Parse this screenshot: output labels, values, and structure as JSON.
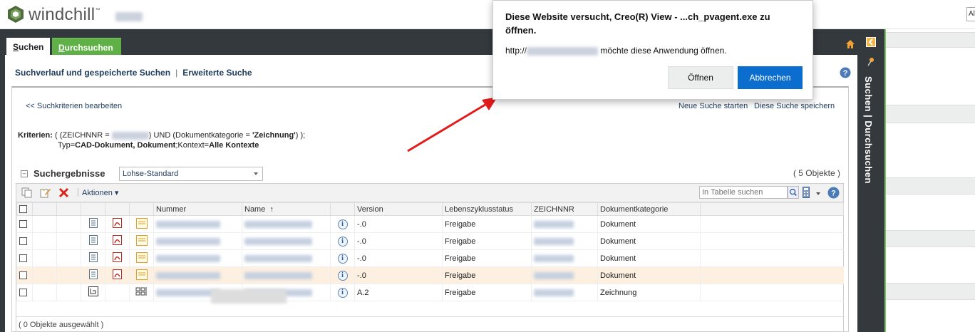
{
  "header": {
    "logo_text": "windchill",
    "logo_mark": "™",
    "right_box_text": "Al"
  },
  "tabs": [
    {
      "label_first": "S",
      "label_rest": "uchen",
      "active": true
    },
    {
      "label_first": "D",
      "label_rest": "urchsuchen",
      "active": false
    }
  ],
  "subnav": {
    "history": "Suchverlauf und gespeicherte Suchen",
    "separator": "|",
    "advanced": "Erweiterte Suche"
  },
  "panel": {
    "edit_link": "<< Suchkriterien bearbeiten",
    "new_search": "Neue Suche starten",
    "save_search": "Diese Suche speichern",
    "criteria_label": "Kriterien:",
    "criteria_l1_a": "( (ZEICHNNR =",
    "criteria_l1_b": ") UND (Dokumentkategorie =",
    "criteria_l1_c": "'Zeichnung'",
    "criteria_l1_d": ") );",
    "criteria_l2_a": "Typ=",
    "criteria_l2_b": "CAD-Dokument, Dokument",
    "criteria_l2_c": ";Kontext=",
    "criteria_l2_d": "Alle Kontexte"
  },
  "results": {
    "title": "Suchergebnisse",
    "view": "Lohse-Standard",
    "count": "( 5 Objekte )",
    "actions_label": "Aktionen",
    "search_placeholder": "In Tabelle suchen",
    "footer": "( 0 Objekte ausgewählt )",
    "columns": [
      "Nummer",
      "Name",
      "Version",
      "Lebenszyklusstatus",
      "ZEICHNNR",
      "Dokumentkategorie"
    ],
    "sort_indicator": "↑",
    "rows": [
      {
        "version": "-.0",
        "status": "Freigabe",
        "kategorie": "Dokument",
        "type": "doc"
      },
      {
        "version": "-.0",
        "status": "Freigabe",
        "kategorie": "Dokument",
        "type": "doc"
      },
      {
        "version": "-.0",
        "status": "Freigabe",
        "kategorie": "Dokument",
        "type": "doc"
      },
      {
        "version": "-.0",
        "status": "Freigabe",
        "kategorie": "Dokument",
        "type": "doc"
      },
      {
        "version": "A.2",
        "status": "Freigabe",
        "kategorie": "Zeichnung",
        "type": "cad"
      }
    ]
  },
  "side": {
    "vertical_label": "Suchen | Durchsuchen"
  },
  "dialog": {
    "title": "Diese Website versucht, Creo(R) View - ...ch_pvagent.exe zu öffnen.",
    "msg_prefix": "http://",
    "msg_suffix": "möchte diese Anwendung öffnen.",
    "open": "Öffnen",
    "cancel": "Abbrechen"
  },
  "colors": {
    "accent_green": "#5fb147",
    "dark_bar": "#34393e",
    "primary_button": "#0b6ecf",
    "highlight_row": "#fdf0e1",
    "arrow": "#e21b1b"
  }
}
